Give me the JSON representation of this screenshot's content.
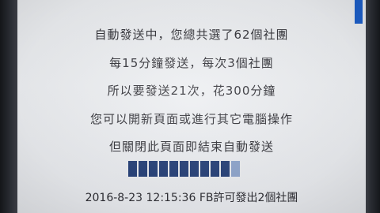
{
  "message": {
    "line1": "自動發送中，您總共選了62個社團",
    "line2": "每15分鐘發送，每次3個社團",
    "line3": "所以要發送21次，花300分鐘",
    "line4": "您可以開新頁面或進行其它電腦操作",
    "line5": "但關閉此頁面即結束自動發送"
  },
  "progress": {
    "segments_total": 11,
    "segments_filled": 10,
    "color": "#1f3a73"
  },
  "status": {
    "text": "2016-8-23 12:15:36 FB許可發出2個社團"
  },
  "colors": {
    "screen_bg": "#eceef1",
    "text": "#2c2c32",
    "corner_tab": "#1d5fc9"
  }
}
